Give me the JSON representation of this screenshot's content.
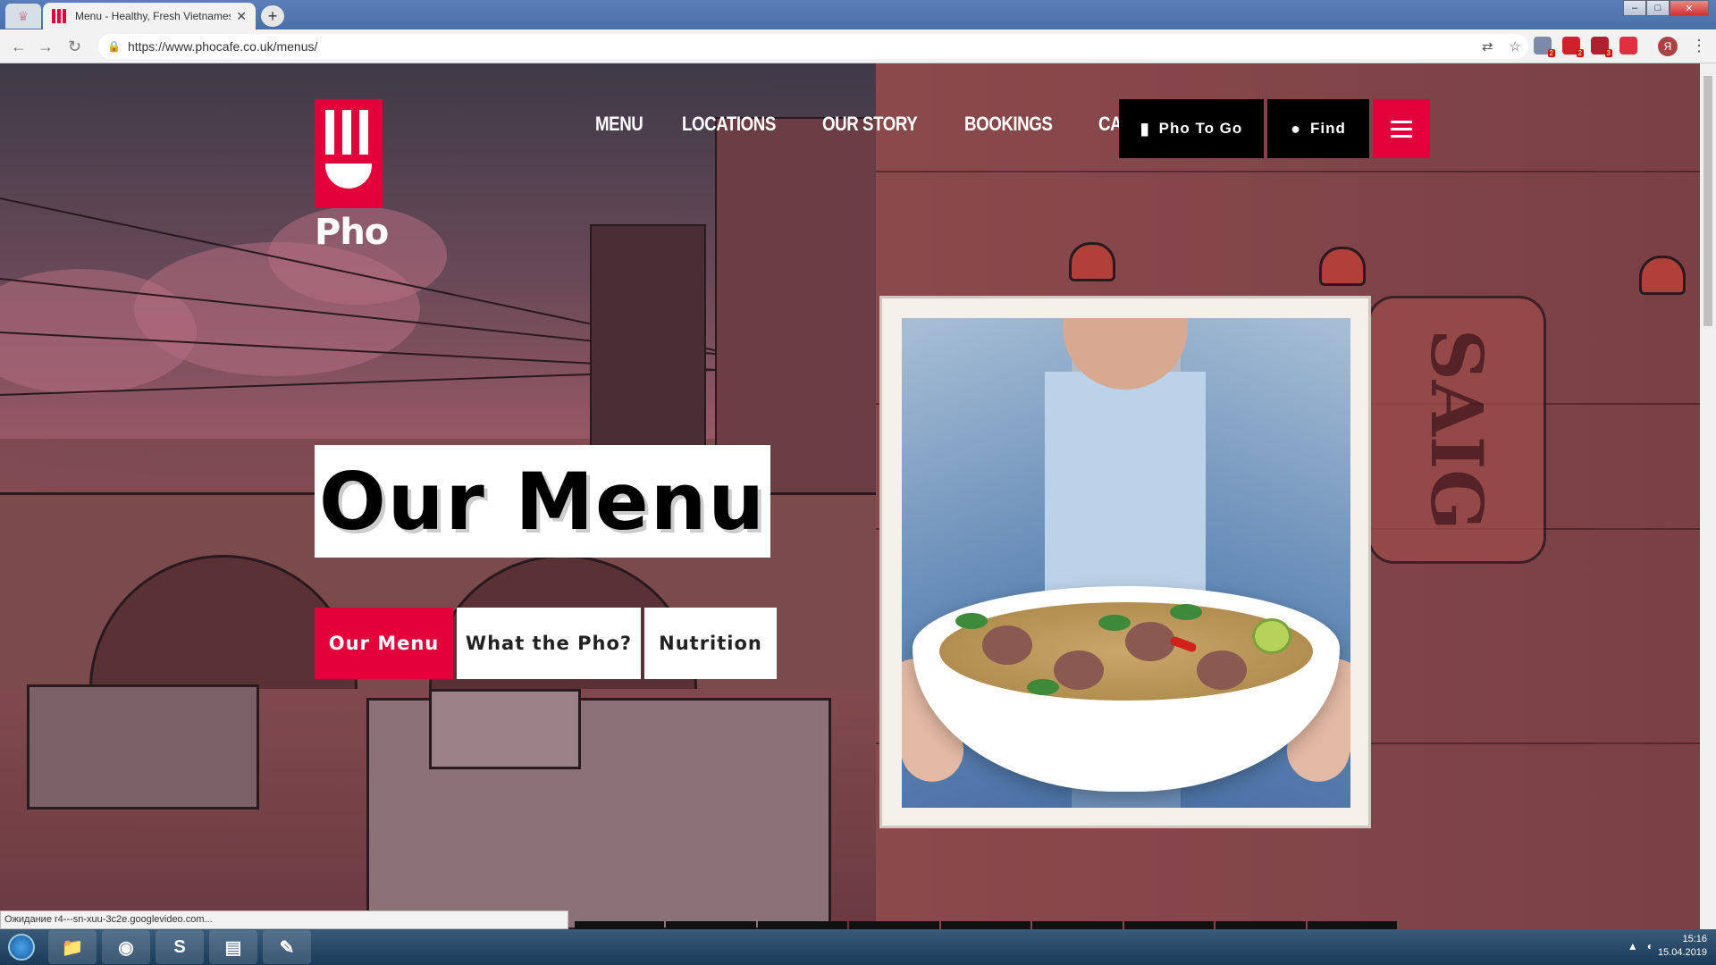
{
  "browser": {
    "tab_title": "Menu - Healthy, Fresh Vietnamese",
    "tab_close": "✕",
    "new_tab": "+",
    "url": "https://www.phocafe.co.uk/menus/",
    "back_icon": "←",
    "forward_icon": "→",
    "reload_icon": "↻",
    "lock_icon": "🔒",
    "translate_icon": "⇄",
    "star_icon": "☆",
    "extensions": [
      {
        "name": "ext-1",
        "color": "#7a8aa8",
        "badge": "2"
      },
      {
        "name": "ext-2",
        "color": "#d0202a",
        "badge": "2"
      },
      {
        "name": "ext-3",
        "color": "#b02030",
        "badge": "3"
      },
      {
        "name": "ext-4",
        "color": "#e03040",
        "badge": ""
      }
    ],
    "profile_letter": "Я",
    "menu_icon": "⋮",
    "window_controls": {
      "minimize": "–",
      "maximize": "□",
      "close": "✕"
    }
  },
  "site": {
    "logo_text": "Pho",
    "nav": [
      "MENU",
      "LOCATIONS",
      "OUR STORY",
      "BOOKINGS",
      "CAREERS"
    ],
    "pho_to_go": "Pho To Go",
    "find": "Find",
    "brand_color": "#e4003b"
  },
  "hero": {
    "title": "Our Menu",
    "tabs": [
      {
        "label": "Our Menu",
        "active": true
      },
      {
        "label": "What the Pho?",
        "active": false
      },
      {
        "label": "Nutrition",
        "active": false
      }
    ]
  },
  "status": {
    "text": "Ожидание r4---sn-xuu-3c2e.googlevideo.com..."
  },
  "taskbar": {
    "apps": [
      "📁",
      "◉",
      "S",
      "▤",
      "✎"
    ],
    "time": "15:16",
    "date": "15.04.2019"
  }
}
